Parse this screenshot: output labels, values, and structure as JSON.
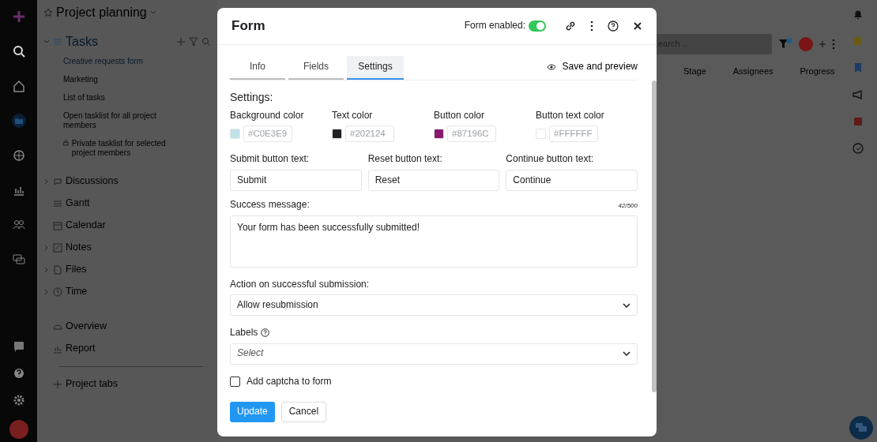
{
  "project": {
    "title": "Project planning"
  },
  "sidebar": {
    "tasks_header": "Tasks",
    "tasks": [
      {
        "label": "Creative requests form",
        "selected": true,
        "private": false
      },
      {
        "label": "Marketing",
        "selected": false,
        "private": false
      },
      {
        "label": "List of tasks",
        "selected": false,
        "private": false
      },
      {
        "label": "Open tasklist for all project members",
        "selected": false,
        "private": false
      },
      {
        "label": "Private tasklist for selected project members",
        "selected": false,
        "private": true
      }
    ],
    "sections": [
      {
        "label": "Discussions",
        "collapsible": true,
        "kind": "chat"
      },
      {
        "label": "Gantt",
        "collapsible": false,
        "kind": "lines"
      },
      {
        "label": "Calendar",
        "collapsible": false,
        "kind": "calendar"
      },
      {
        "label": "Notes",
        "collapsible": true,
        "kind": "note"
      },
      {
        "label": "Files",
        "collapsible": true,
        "kind": "file"
      },
      {
        "label": "Time",
        "collapsible": true,
        "kind": "clock"
      }
    ],
    "pages": [
      {
        "label": "Overview",
        "kind": "gauge"
      },
      {
        "label": "Report",
        "kind": "chart"
      }
    ],
    "add_tab": "Project tabs"
  },
  "toolbar": {
    "search_placeholder": "earch .."
  },
  "columns": [
    "Stage",
    "Assignees",
    "Progress"
  ],
  "modal": {
    "title": "Form",
    "toggle_label": "Form enabled:",
    "enabled": true,
    "tabs": [
      {
        "label": "Info",
        "selected": false
      },
      {
        "label": "Fields",
        "selected": false
      },
      {
        "label": "Settings",
        "selected": true
      }
    ],
    "preview": "Save and preview",
    "heading": "Settings:",
    "colors": [
      {
        "label": "Background color",
        "value": "#C0E3E9",
        "color": "#c0e3e9"
      },
      {
        "label": "Text color",
        "value": "#202124",
        "color": "#202124"
      },
      {
        "label": "Button color",
        "value": "#87196C",
        "color": "#87196c"
      },
      {
        "label": "Button text color",
        "value": "#FFFFFF",
        "color": "#ffffff"
      }
    ],
    "text_fields": [
      {
        "label": "Submit button text:",
        "value": "Submit"
      },
      {
        "label": "Reset button text:",
        "value": "Reset"
      },
      {
        "label": "Continue button text:",
        "value": "Continue"
      }
    ],
    "success": {
      "label": "Success message:",
      "counter": "42/500",
      "value": "Your form has been successfully submitted!"
    },
    "action": {
      "label": "Action on successful submission:",
      "value": "Allow resubmission"
    },
    "labels": {
      "label": "Labels",
      "placeholder": "Select"
    },
    "captcha": {
      "label": "Add captcha to form",
      "checked": false
    },
    "buttons": [
      "Update",
      "Cancel"
    ]
  }
}
